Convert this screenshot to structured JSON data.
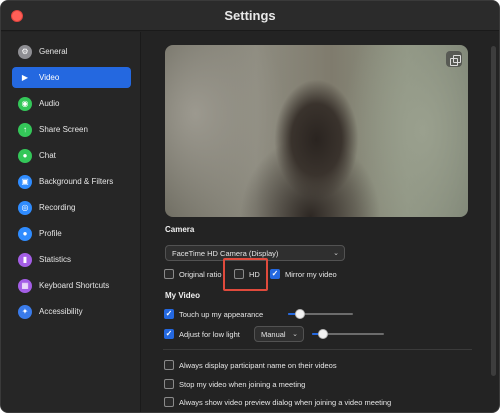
{
  "window": {
    "title": "Settings"
  },
  "sidebar": {
    "items": [
      {
        "label": "General",
        "icon": "gear-icon",
        "glyph": "⚙",
        "color": "#8e8e93",
        "active": false
      },
      {
        "label": "Video",
        "icon": "video-camera-icon",
        "glyph": "▶",
        "color": "#ffffff",
        "active": true
      },
      {
        "label": "Audio",
        "icon": "headphones-icon",
        "glyph": "◉",
        "color": "#34c759",
        "active": false
      },
      {
        "label": "Share Screen",
        "icon": "share-screen-icon",
        "glyph": "↑",
        "color": "#34c759",
        "active": false
      },
      {
        "label": "Chat",
        "icon": "chat-bubble-icon",
        "glyph": "●",
        "color": "#34c759",
        "active": false
      },
      {
        "label": "Background & Filters",
        "icon": "person-background-icon",
        "glyph": "▣",
        "color": "#2f8cff",
        "active": false
      },
      {
        "label": "Recording",
        "icon": "record-icon",
        "glyph": "◎",
        "color": "#2f8cff",
        "active": false
      },
      {
        "label": "Profile",
        "icon": "profile-icon",
        "glyph": "●",
        "color": "#2f8cff",
        "active": false
      },
      {
        "label": "Statistics",
        "icon": "statistics-icon",
        "glyph": "▮",
        "color": "#a45ee6",
        "active": false
      },
      {
        "label": "Keyboard Shortcuts",
        "icon": "keyboard-icon",
        "glyph": "▦",
        "color": "#a45ee6",
        "active": false
      },
      {
        "label": "Accessibility",
        "icon": "accessibility-icon",
        "glyph": "✦",
        "color": "#3a7bea",
        "active": false
      }
    ]
  },
  "camera": {
    "heading": "Camera",
    "selected_device": "FaceTime HD Camera (Display)",
    "original_ratio_label": "Original ratio",
    "original_ratio_checked": false,
    "hd_label": "HD",
    "hd_checked": false,
    "mirror_label": "Mirror my video",
    "mirror_checked": true
  },
  "my_video": {
    "heading": "My Video",
    "touch_up_label": "Touch up my appearance",
    "touch_up_checked": true,
    "touch_up_level": 0.18,
    "low_light_label": "Adjust for low light",
    "low_light_checked": true,
    "low_light_mode": "Manual",
    "low_light_level": 0.15
  },
  "options": {
    "always_display_names": "Always display participant name on their videos",
    "always_display_names_checked": false,
    "stop_video_on_join": "Stop my video when joining a meeting",
    "stop_video_on_join_checked": false,
    "show_preview_dialog": "Always show video preview dialog when joining a video meeting",
    "show_preview_dialog_checked": false
  },
  "colors": {
    "accent": "#2468e0",
    "highlight_box": "#e04a3c"
  }
}
